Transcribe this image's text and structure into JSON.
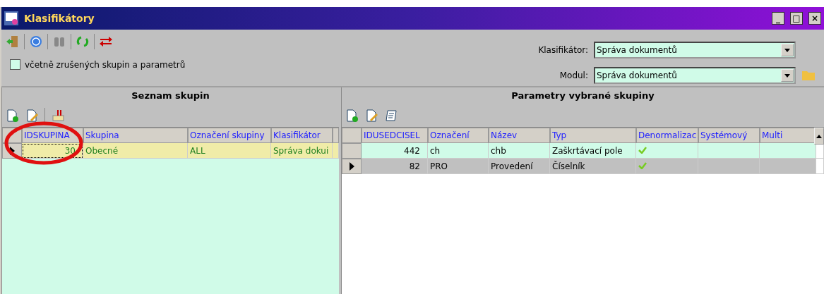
{
  "window": {
    "title": "Klasifikátory",
    "controls": [
      "_",
      "□",
      "×"
    ]
  },
  "options": {
    "include_cancelled": {
      "label": "včetně zrušených skupin a parametrů",
      "checked": false
    }
  },
  "filters": [
    {
      "label": "Klasifikátor:",
      "value": "Správa dokumentů",
      "has_folder": false
    },
    {
      "label": "Modul:",
      "value": "Správa dokumentů",
      "has_folder": true
    }
  ],
  "groups": {
    "title": "Seznam skupin",
    "columns": [
      "IDSKUPINA",
      "Skupina",
      "Označení skupiny",
      "Klasifikátor"
    ],
    "rows": [
      {
        "cells": [
          "30",
          "Obecné",
          "ALL",
          "Správa dokui"
        ],
        "selected": true,
        "current": true
      }
    ]
  },
  "parameters": {
    "title": "Parametry vybrané skupiny",
    "columns": [
      "IDUSEDCISEL",
      "Označení",
      "Název",
      "Typ",
      "Denormalizac",
      "Systémový",
      "Multi"
    ],
    "rows": [
      {
        "cells": [
          "442",
          "ch",
          "chb",
          "Zaškrtávací pole"
        ],
        "denormalized": true,
        "selected": true,
        "current": false
      },
      {
        "cells": [
          "82",
          "PRO",
          "Provedení",
          "Číselník"
        ],
        "denormalized": true,
        "selected": false,
        "current": true
      }
    ]
  }
}
